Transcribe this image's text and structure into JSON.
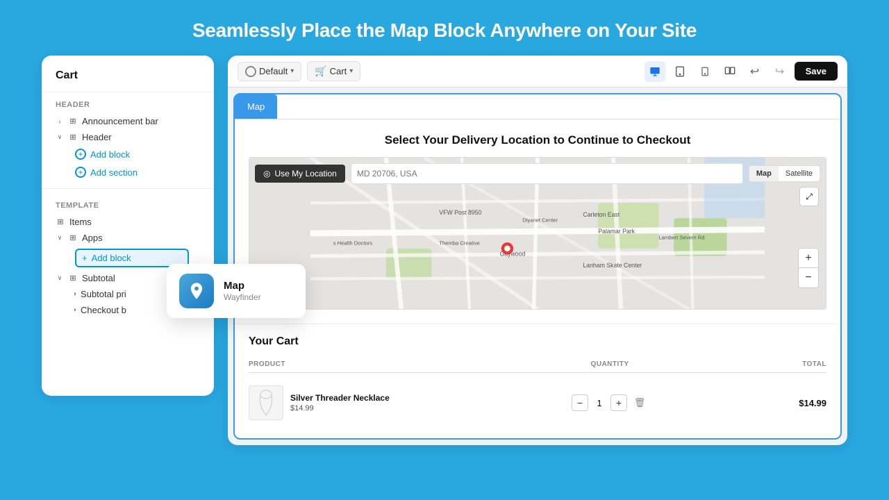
{
  "page": {
    "title": "Seamlessly Place the Map Block Anywhere on Your Site",
    "background_color": "#29a8e0"
  },
  "left_panel": {
    "title": "Cart",
    "sections": {
      "header_label": "Header",
      "announcement_bar": "Announcement bar",
      "header": "Header",
      "add_block": "Add block",
      "add_section": "Add section",
      "template_label": "Template",
      "items": "Items",
      "apps": "Apps",
      "add_block_apps": "Add block",
      "subtotal_label": "Subtotal",
      "subtotal_price": "Subtotal pri",
      "checkout_btn": "Checkout b"
    }
  },
  "tooltip": {
    "name": "Map",
    "subtitle": "Wayfinder"
  },
  "browser": {
    "dropdown_default": "Default",
    "dropdown_cart": "Cart",
    "save_label": "Save",
    "map_tab": "Map",
    "map_heading": "Select Your Delivery Location to Continue to Checkout",
    "use_location_btn": "Use My Location",
    "address_placeholder": "MD 20706, USA",
    "map_type_map": "Map",
    "map_type_satellite": "Satellite",
    "cart_title": "our Cart",
    "table_headers": {
      "product": "PRODUCT",
      "quantity": "QUANTITY",
      "total": "TOTAL"
    },
    "cart_item": {
      "name": "Silver Threader Necklace",
      "price": "$14.99",
      "qty": "1",
      "total": "$14.99"
    }
  }
}
